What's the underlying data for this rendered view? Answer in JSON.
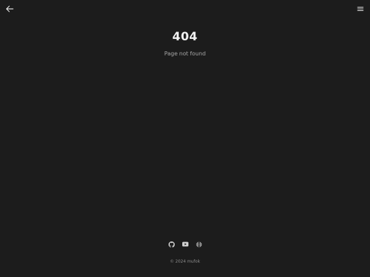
{
  "header": {
    "back_icon": "arrow-left-icon",
    "menu_icon": "hamburger-menu-icon"
  },
  "main": {
    "title": "404",
    "subtitle": "Page not found"
  },
  "social": [
    {
      "icon": "github-icon"
    },
    {
      "icon": "youtube-icon"
    },
    {
      "icon": "globe-icon"
    }
  ],
  "footer": {
    "copyright": "© 2024 mufok"
  },
  "colors": {
    "background": "#1c1c1c",
    "text": "#f2f2f2",
    "muted": "#a8a8a8"
  }
}
